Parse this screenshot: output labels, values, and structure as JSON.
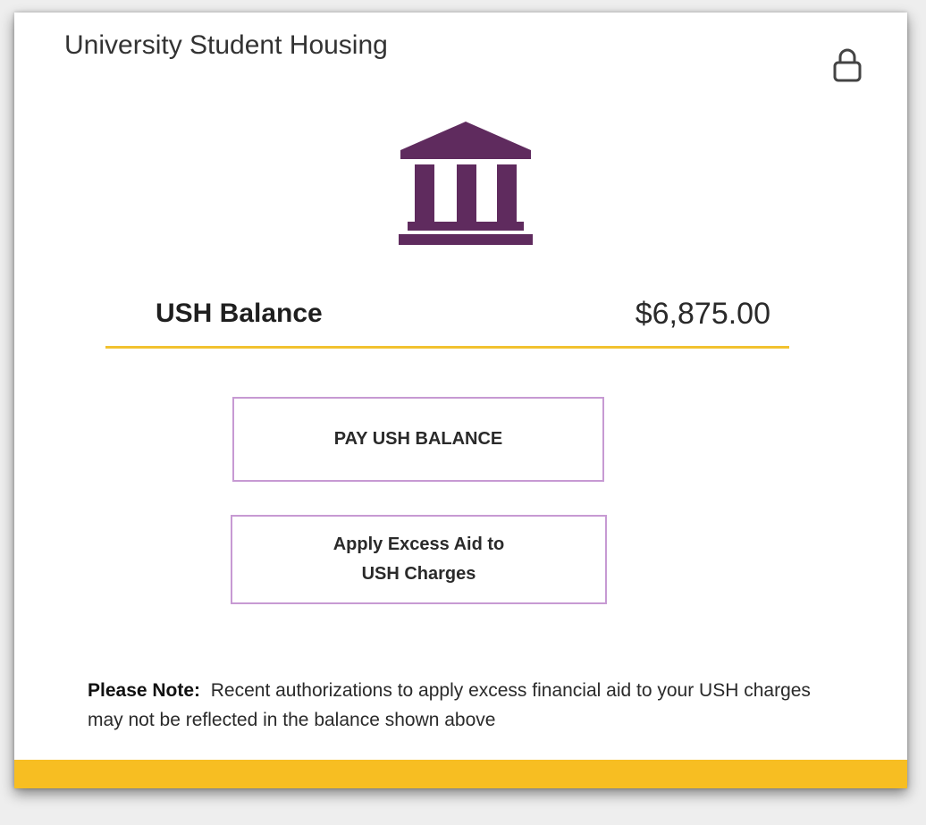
{
  "card": {
    "title": "University Student Housing",
    "lock_icon": "lock-icon",
    "bank_icon": "bank-icon"
  },
  "balance": {
    "label": "USH Balance",
    "amount": "$6,875.00"
  },
  "buttons": {
    "pay_label": "PAY USH BALANCE",
    "apply_aid_line1": "Apply Excess Aid to",
    "apply_aid_line2": "USH Charges"
  },
  "note": {
    "label": "Please Note:",
    "text": "Recent authorizations to apply excess financial aid to your USH charges may not be reflected in the balance shown above"
  },
  "colors": {
    "accent_purple": "#5f2b5e",
    "accent_gold": "#f7be22",
    "button_border": "#c79ad3"
  }
}
